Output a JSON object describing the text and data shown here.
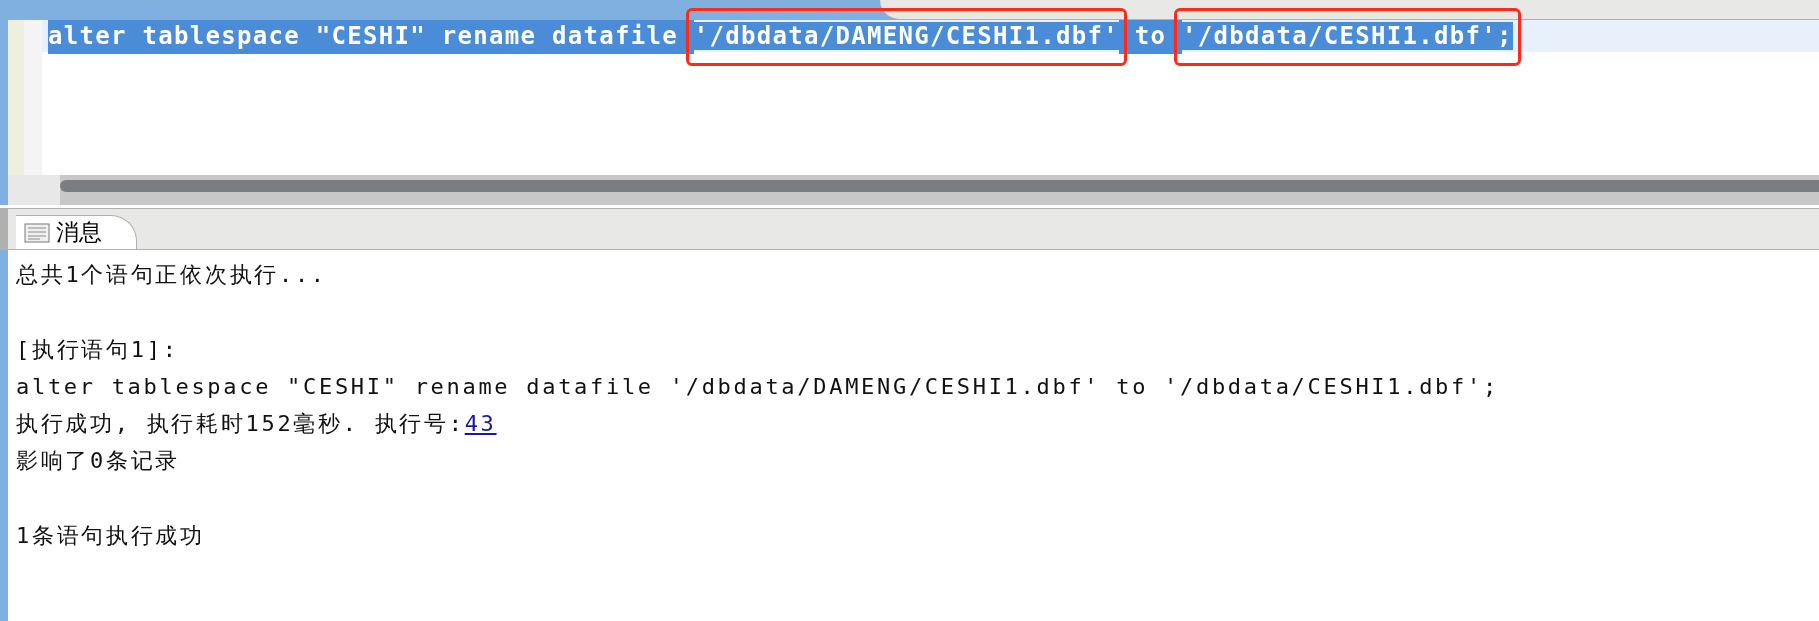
{
  "editor": {
    "code_segments": [
      {
        "text": "alter tablespace \"CESHI\" rename datafile ",
        "selected": true,
        "boxed": false
      },
      {
        "text": "'/dbdata/DAMENG/CESHI1.dbf'",
        "selected": true,
        "boxed": true
      },
      {
        "text": " to ",
        "selected": true,
        "boxed": false
      },
      {
        "text": "'/dbdata/CESHI1.dbf';",
        "selected": true,
        "boxed": true
      }
    ]
  },
  "messages_tab": {
    "label": "消息",
    "selected": true
  },
  "message_blocks": [
    {
      "lines": [
        {
          "text": "总共1个语句正依次执行..."
        }
      ]
    },
    {
      "lines": [
        {
          "text": "[执行语句1]:"
        },
        {
          "text": "alter tablespace \"CESHI\" rename datafile '/dbdata/DAMENG/CESHI1.dbf' to '/dbdata/CESHI1.dbf';"
        },
        {
          "text": "执行成功, 执行耗时152毫秒. 执行号:",
          "link": "43"
        },
        {
          "text": "影响了0条记录"
        }
      ]
    },
    {
      "lines": [
        {
          "text": "1条语句执行成功"
        }
      ]
    }
  ]
}
